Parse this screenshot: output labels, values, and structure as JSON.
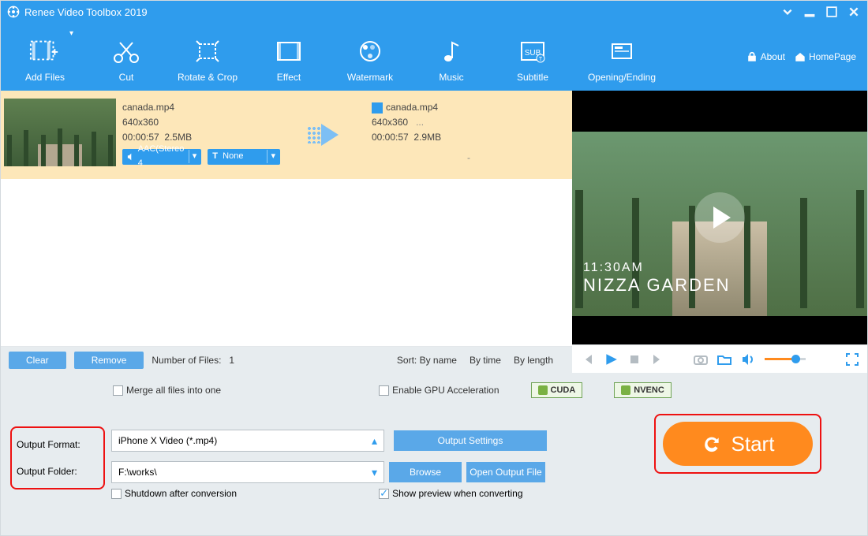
{
  "app": {
    "title": "Renee Video Toolbox 2019"
  },
  "toolbar": {
    "items": [
      {
        "label": "Add Files"
      },
      {
        "label": "Cut"
      },
      {
        "label": "Rotate & Crop"
      },
      {
        "label": "Effect"
      },
      {
        "label": "Watermark"
      },
      {
        "label": "Music"
      },
      {
        "label": "Subtitle"
      },
      {
        "label": "Opening/Ending"
      }
    ],
    "about": "About",
    "homepage": "HomePage"
  },
  "file": {
    "source": {
      "name": "canada.mp4",
      "resolution": "640x360",
      "duration": "00:00:57",
      "size": "2.5MB"
    },
    "target": {
      "name": "canada.mp4",
      "resolution": "640x360",
      "resolution_extra": "...",
      "duration": "00:00:57",
      "size": "2.9MB"
    },
    "audio_chip": "AAC(Stereo 4",
    "subtitle_chip": "None",
    "dash": "-"
  },
  "listctrl": {
    "clear": "Clear",
    "remove": "Remove",
    "count_label": "Number of Files:",
    "count_value": "1",
    "sort_label": "Sort:",
    "sort_byname": "By name",
    "sort_bytime": "By time",
    "sort_bylength": "By length"
  },
  "preview": {
    "line1": "11:30AM",
    "line2": "NIZZA GARDEN"
  },
  "bottom": {
    "merge": "Merge all files into one",
    "gpu": "Enable GPU Acceleration",
    "cuda": "CUDA",
    "nvenc": "NVENC",
    "format_label": "Output Format:",
    "format_value": "iPhone X Video (*.mp4)",
    "output_settings": "Output Settings",
    "folder_label": "Output Folder:",
    "folder_value": "F:\\works\\",
    "browse": "Browse",
    "open_output": "Open Output File",
    "shutdown": "Shutdown after conversion",
    "show_preview": "Show preview when converting",
    "start": "Start"
  }
}
